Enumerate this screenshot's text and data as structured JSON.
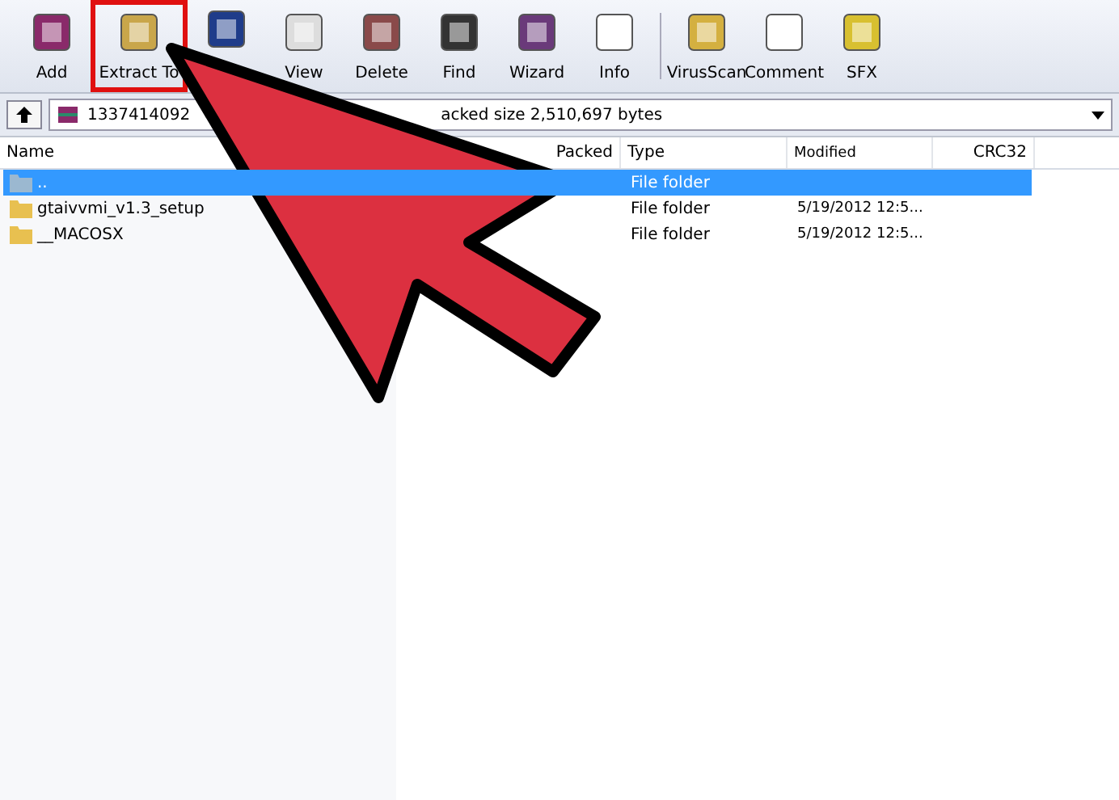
{
  "toolbar": {
    "buttons": [
      {
        "label": "Add",
        "highlighted": false
      },
      {
        "label": "Extract To",
        "highlighted": true
      },
      {
        "highlighted": false
      },
      {
        "label": "View",
        "highlighted": false
      },
      {
        "label": "Delete",
        "highlighted": false
      },
      {
        "label": "Find",
        "highlighted": false
      },
      {
        "label": "Wizard",
        "highlighted": false
      },
      {
        "label": "Info",
        "highlighted": false
      },
      {
        "label": "VirusScan",
        "highlighted": false
      },
      {
        "label": "Comment",
        "highlighted": false
      },
      {
        "label": "SFX",
        "highlighted": false
      }
    ]
  },
  "address_bar": {
    "text_start": "1337414092",
    "text_end": "acked size 2,510,697 bytes"
  },
  "table": {
    "columns": [
      "Name",
      "Packed",
      "Type",
      "Modified",
      "CRC32"
    ],
    "rows": [
      {
        "name": "..",
        "type": "File folder",
        "modified": "",
        "selected": true
      },
      {
        "name": "gtaivvmi_v1.3_setup",
        "type": "File folder",
        "modified": "5/19/2012 12:5...",
        "selected": false
      },
      {
        "name": "__MACOSX",
        "type": "File folder",
        "modified": "5/19/2012 12:5...",
        "selected": false
      }
    ]
  }
}
